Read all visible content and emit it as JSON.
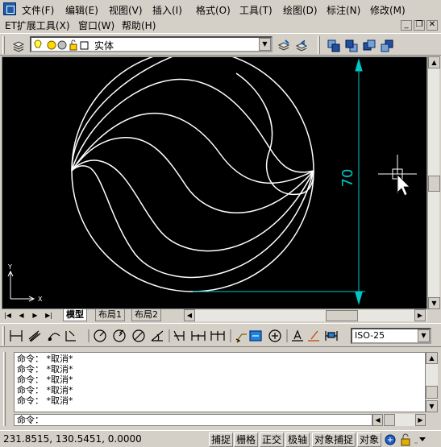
{
  "menu": {
    "items": [
      "文件(F)",
      "编辑(E)",
      "视图(V)",
      "插入(I)",
      "格式(O)",
      "工具(T)",
      "绘图(D)",
      "标注(N)",
      "修改(M)"
    ],
    "row2": [
      "ET扩展工具(X)",
      "窗口(W)",
      "帮助(H)"
    ]
  },
  "layer": {
    "current": "实体"
  },
  "drawing": {
    "dimension_text": "70",
    "ucs_x": "X",
    "ucs_y": "Y",
    "colors": {
      "background": "#000000",
      "geometry": "#ffffff",
      "dimension": "#00c8c8"
    }
  },
  "tabs": [
    "模型",
    "布局1",
    "布局2"
  ],
  "dimstyle": {
    "value": "ISO-25"
  },
  "command": {
    "history": [
      "命令： *取消*",
      "命令： *取消*",
      "命令： *取消*",
      "命令： *取消*",
      "命令： *取消*"
    ],
    "prompt": "命令："
  },
  "status": {
    "coords": "231.8515, 130.5451, 0.0000",
    "buttons": [
      "捕捉",
      "栅格",
      "正交",
      "极轴",
      "对象捕捉",
      "对象"
    ]
  }
}
